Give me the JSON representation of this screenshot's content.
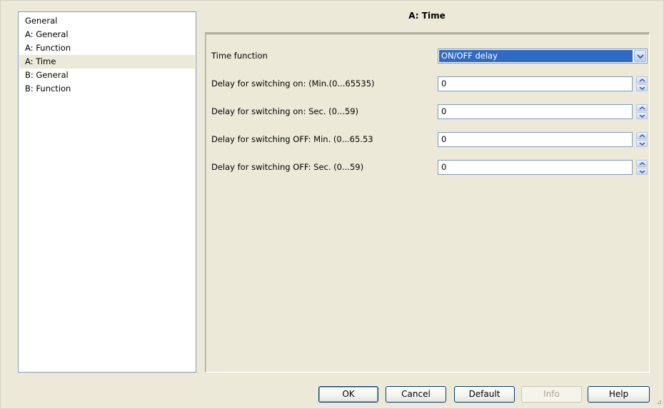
{
  "tree": {
    "items": [
      {
        "label": "General",
        "selected": false
      },
      {
        "label": "A: General",
        "selected": false
      },
      {
        "label": "A: Function",
        "selected": false
      },
      {
        "label": "A: Time",
        "selected": true
      },
      {
        "label": "B: General",
        "selected": false
      },
      {
        "label": "B: Function",
        "selected": false
      }
    ]
  },
  "page": {
    "title": "A: Time"
  },
  "params": {
    "time_function": {
      "label": "Time function",
      "value": "ON/OFF delay"
    },
    "delay_on_min": {
      "label": "Delay for switching on: (Min.(0...65535)",
      "value": "0"
    },
    "delay_on_sec": {
      "label": "Delay for switching on: Sec. (0...59)",
      "value": "0"
    },
    "delay_off_min": {
      "label": "Delay for switching OFF: Min. (0...65.53",
      "value": "0"
    },
    "delay_off_sec": {
      "label": "Delay for switching OFF: Sec. (0...59)",
      "value": "0"
    }
  },
  "buttons": {
    "ok": "OK",
    "cancel": "Cancel",
    "default": "Default",
    "info": "Info",
    "help": "Help"
  },
  "icons": {
    "dropdown": "chevron-down-icon",
    "spin_up": "spin-up-icon",
    "spin_down": "spin-down-icon",
    "resize": "resize-grip-icon"
  },
  "colors": {
    "background": "#ece9d8",
    "selection": "#316ac5",
    "border": "#7f9db9"
  }
}
